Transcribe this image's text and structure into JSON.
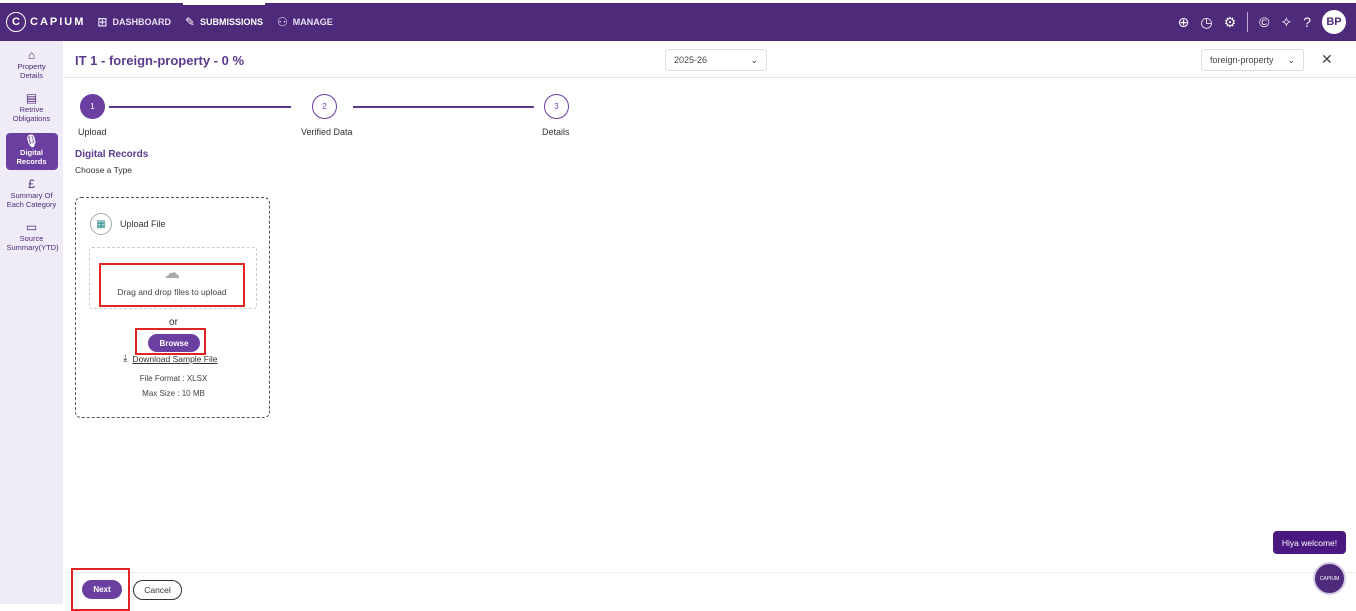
{
  "app": {
    "logo_text": "CAPIUM",
    "logo_mark": "C"
  },
  "nav": {
    "dashboard": "DASHBOARD",
    "submissions": "SUBMISSIONS",
    "manage": "MANAGE"
  },
  "user": {
    "initials": "BP"
  },
  "sidebar": {
    "items": [
      {
        "label": "Property Details",
        "icon": "home-icon"
      },
      {
        "label": "Retrive Obligations",
        "icon": "document-icon"
      },
      {
        "label": "Digital Records",
        "icon": "microphone-icon",
        "active": true
      },
      {
        "label": "Summary Of Each Category",
        "icon": "pound-icon"
      },
      {
        "label": "Source Summary(YTD)",
        "icon": "folder-icon"
      }
    ]
  },
  "header": {
    "title": "IT 1 - foreign-property - 0 %",
    "year_select": "2025-26",
    "type_select": "foreign-property"
  },
  "stepper": {
    "steps": [
      {
        "number": "1",
        "label": "Upload",
        "active": true
      },
      {
        "number": "2",
        "label": "Verified Data",
        "active": false
      },
      {
        "number": "3",
        "label": "Details",
        "active": false
      }
    ]
  },
  "section": {
    "title": "Digital Records",
    "subtitle": "Choose a Type"
  },
  "upload": {
    "title": "Upload File",
    "drop_text": "Drag and drop files to upload",
    "or_text": "or",
    "browse_label": "Browse",
    "download_label": "Download Sample File",
    "file_format": "File Format : XLSX",
    "max_size": "Max Size : 10 MB"
  },
  "footer": {
    "next_label": "Next",
    "cancel_label": "Cancel"
  },
  "chat": {
    "welcome_text": "Hiya welcome!",
    "bubble_text": "CAPIUM"
  },
  "colors": {
    "brand": "#4e2a7a",
    "accent": "#6b3fa0",
    "highlight": "#e02424"
  }
}
